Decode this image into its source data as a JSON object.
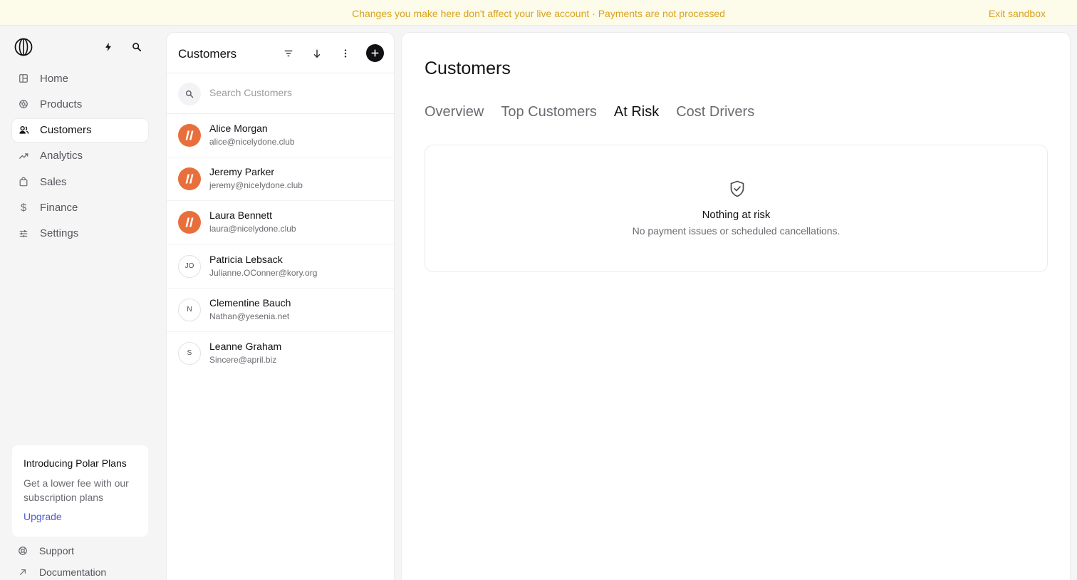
{
  "banner": {
    "message": "Changes you make here don't affect your live account · Payments are not processed",
    "exit_label": "Exit sandbox"
  },
  "sidebar": {
    "top_icons": [
      "bolt-icon",
      "search-icon"
    ],
    "nav": [
      {
        "label": "Home",
        "icon": "home-icon",
        "active": false
      },
      {
        "label": "Products",
        "icon": "products-icon",
        "active": false
      },
      {
        "label": "Customers",
        "icon": "customers-icon",
        "active": true
      },
      {
        "label": "Analytics",
        "icon": "analytics-icon",
        "active": false
      },
      {
        "label": "Sales",
        "icon": "sales-icon",
        "active": false
      },
      {
        "label": "Finance",
        "icon": "finance-icon",
        "active": false
      },
      {
        "label": "Settings",
        "icon": "settings-icon",
        "active": false
      }
    ],
    "promo": {
      "title": "Introducing Polar Plans",
      "description": "Get a lower fee with our subscription plans",
      "link": "Upgrade"
    },
    "footer": [
      {
        "label": "Support",
        "icon": "support-icon"
      },
      {
        "label": "Documentation",
        "icon": "external-link-icon"
      }
    ]
  },
  "customer_list": {
    "title": "Customers",
    "search_placeholder": "Search Customers",
    "customers": [
      {
        "name": "Alice Morgan",
        "email": "alice@nicelydone.club",
        "avatar": "brand",
        "initials": ""
      },
      {
        "name": "Jeremy Parker",
        "email": "jeremy@nicelydone.club",
        "avatar": "brand",
        "initials": ""
      },
      {
        "name": "Laura Bennett",
        "email": "laura@nicelydone.club",
        "avatar": "brand",
        "initials": ""
      },
      {
        "name": "Patricia Lebsack",
        "email": "Julianne.OConner@kory.org",
        "avatar": "initials",
        "initials": "JO"
      },
      {
        "name": "Clementine Bauch",
        "email": "Nathan@yesenia.net",
        "avatar": "initials",
        "initials": "N"
      },
      {
        "name": "Leanne Graham",
        "email": "Sincere@april.biz",
        "avatar": "initials",
        "initials": "S"
      }
    ]
  },
  "main": {
    "title": "Customers",
    "tabs": [
      {
        "label": "Overview",
        "active": false
      },
      {
        "label": "Top Customers",
        "active": false
      },
      {
        "label": "At Risk",
        "active": true
      },
      {
        "label": "Cost Drivers",
        "active": false
      }
    ],
    "empty_state": {
      "icon": "shield-check-icon",
      "title": "Nothing at risk",
      "description": "No payment issues or scheduled cancellations."
    }
  },
  "colors": {
    "banner_text": "#d9a21b",
    "brand_avatar": "#e86f3c",
    "link": "#4a5ad8"
  }
}
